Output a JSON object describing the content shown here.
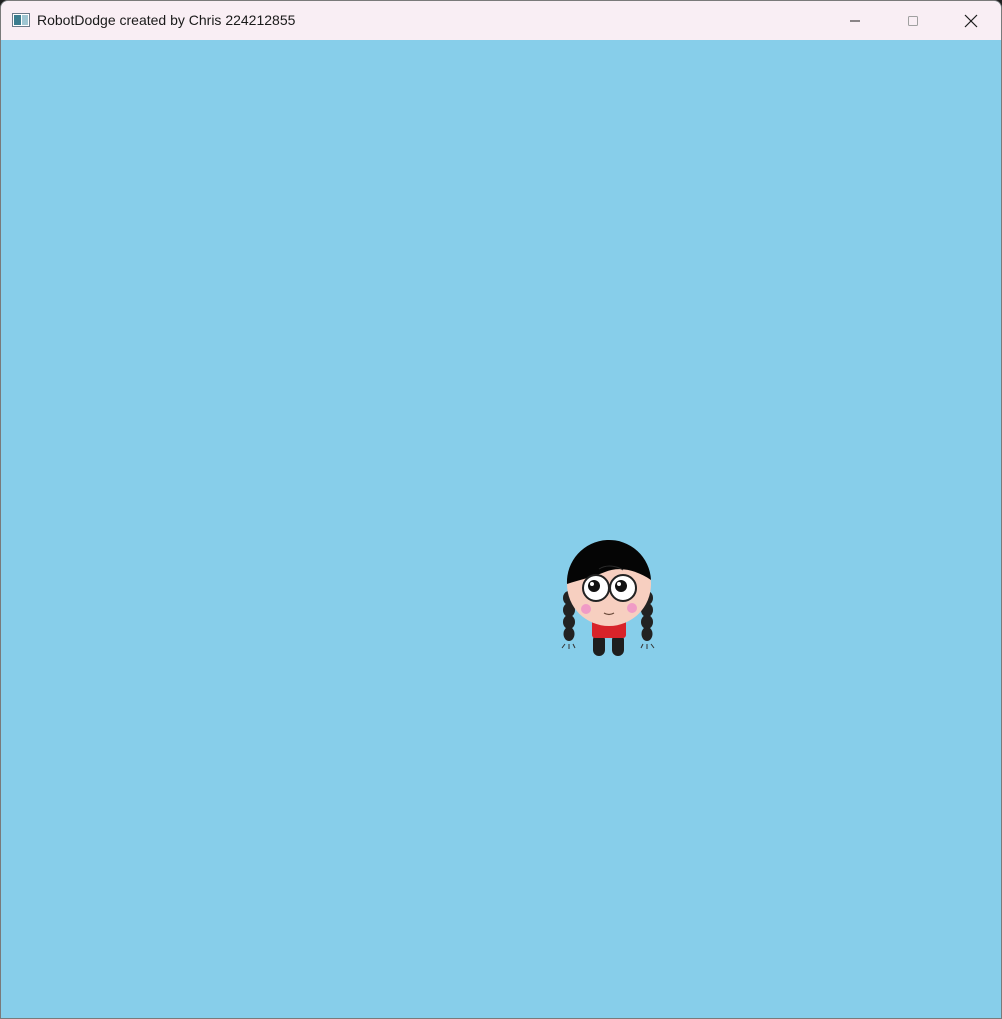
{
  "window": {
    "title": "RobotDodge created by Chris 224212855",
    "icon": "app-window-icon",
    "controls": [
      "minimize-icon",
      "maximize-icon",
      "close-icon"
    ]
  },
  "game": {
    "background_color": "#87ceea",
    "sprite": "player-girl-sprite"
  }
}
